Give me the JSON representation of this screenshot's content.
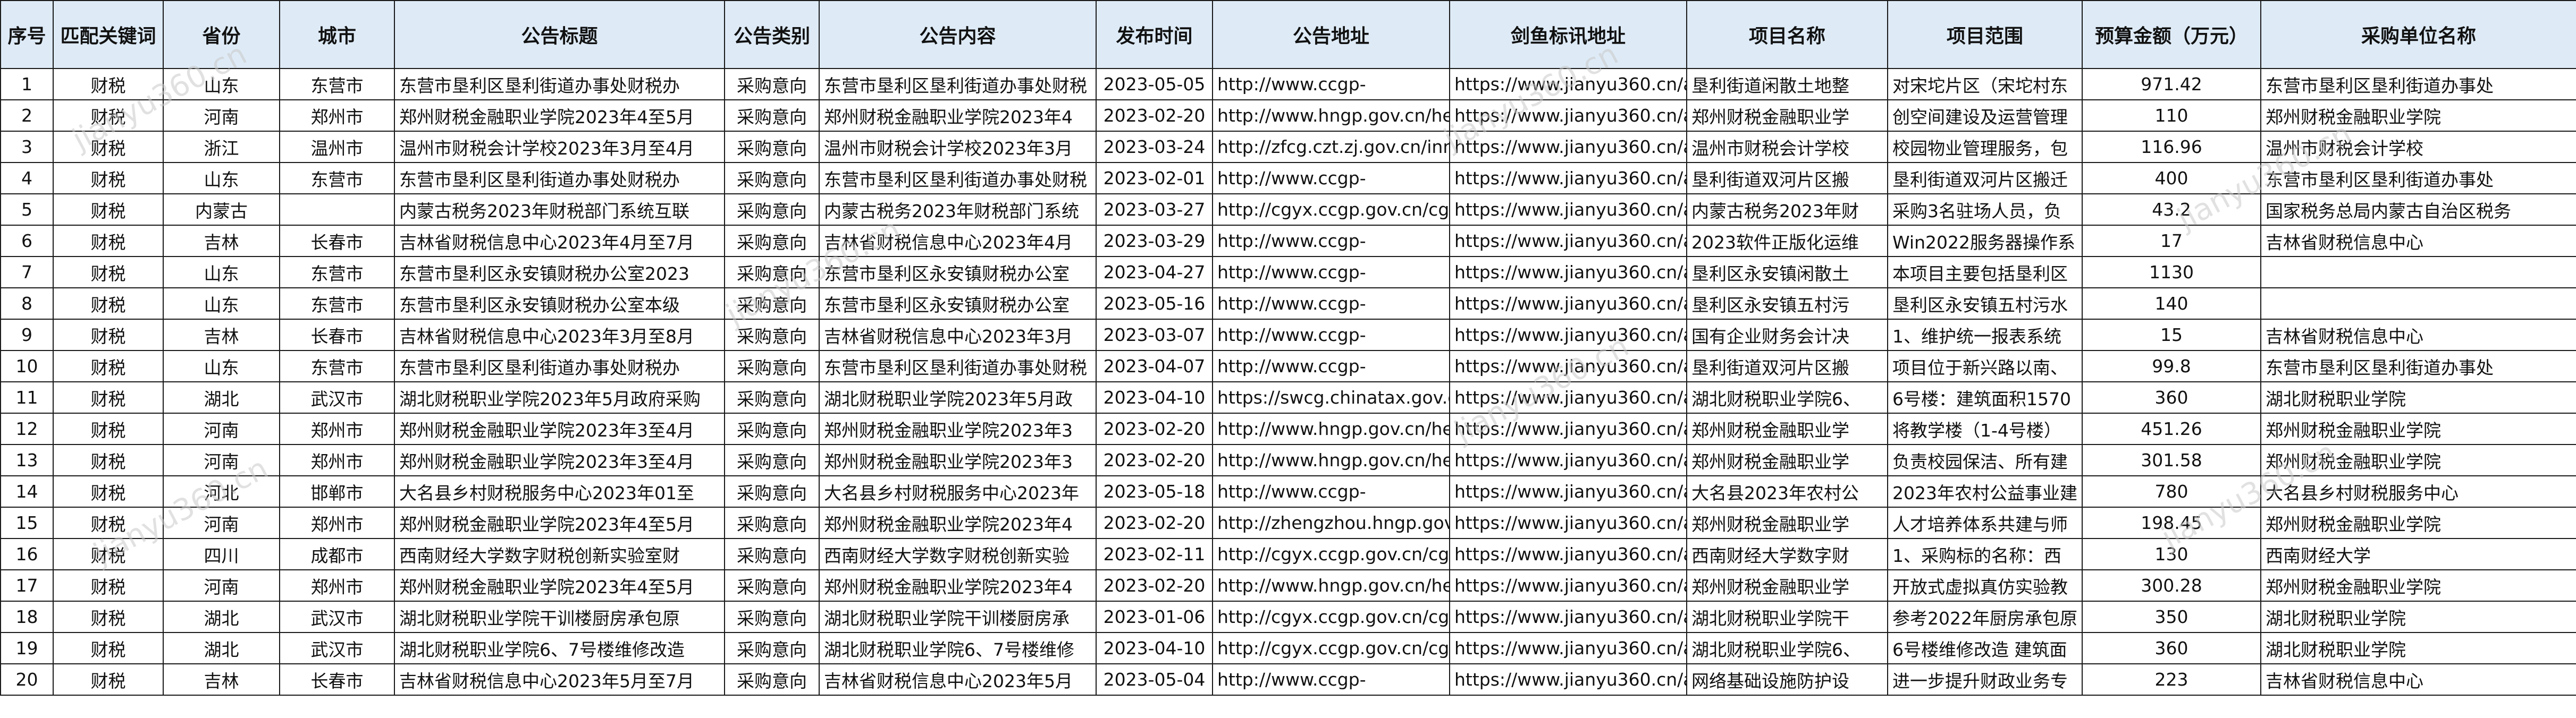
{
  "headers": [
    "序号",
    "匹配关键词",
    "省份",
    "城市",
    "公告标题",
    "公告类别",
    "公告内容",
    "发布时间",
    "公告地址",
    "剑鱼标讯地址",
    "项目名称",
    "项目范围",
    "预算金额（万元）",
    "采购单位名称"
  ],
  "watermark": "jianyu360.cn",
  "rows": [
    {
      "no": "1",
      "kw": "财税",
      "prov": "山东",
      "city": "东营市",
      "title": "东营市垦利区垦利街道办事处财税办",
      "cat": "采购意向",
      "content": "东营市垦利区垦利街道办事处财税",
      "date": "2023-05-05",
      "url": "http://www.ccgp-",
      "jy": "https://www.jianyu360.cn/ar",
      "proj": "垦利街道闲散土地整",
      "scope": "对宋坨片区（宋坨村东",
      "budget": "971.42",
      "buyer": "东营市垦利区垦利街道办事处"
    },
    {
      "no": "2",
      "kw": "财税",
      "prov": "河南",
      "city": "郑州市",
      "title": "郑州财税金融职业学院2023年4至5月",
      "cat": "采购意向",
      "content": "郑州财税金融职业学院2023年4",
      "date": "2023-02-20",
      "url": "http://www.hngp.gov.cn/he",
      "jy": "https://www.jianyu360.cn/ar",
      "proj": "郑州财税金融职业学",
      "scope": "创空间建设及运营管理",
      "budget": "110",
      "buyer": "郑州财税金融职业学院"
    },
    {
      "no": "3",
      "kw": "财税",
      "prov": "浙江",
      "city": "温州市",
      "title": "温州市财税会计学校2023年3月至4月",
      "cat": "采购意向",
      "content": "温州市财税会计学校2023年3月",
      "date": "2023-03-24",
      "url": "http://zfcg.czt.zj.gov.cn/inn",
      "jy": "https://www.jianyu360.cn/ar",
      "proj": "温州市财税会计学校",
      "scope": "校园物业管理服务，包",
      "budget": "116.96",
      "buyer": "温州市财税会计学校"
    },
    {
      "no": "4",
      "kw": "财税",
      "prov": "山东",
      "city": "东营市",
      "title": "东营市垦利区垦利街道办事处财税办",
      "cat": "采购意向",
      "content": "东营市垦利区垦利街道办事处财税",
      "date": "2023-02-01",
      "url": "http://www.ccgp-",
      "jy": "https://www.jianyu360.cn/ar",
      "proj": "垦利街道双河片区搬",
      "scope": "垦利街道双河片区搬迁",
      "budget": "400",
      "buyer": "东营市垦利区垦利街道办事处"
    },
    {
      "no": "5",
      "kw": "财税",
      "prov": "内蒙古",
      "city": "",
      "title": "内蒙古税务2023年财税部门系统互联",
      "cat": "采购意向",
      "content": "内蒙古税务2023年财税部门系统",
      "date": "2023-03-27",
      "url": "http://cgyx.ccgp.gov.cn/cgy",
      "jy": "https://www.jianyu360.cn/ar",
      "proj": "内蒙古税务2023年财",
      "scope": "采购3名驻场人员，负",
      "budget": "43.2",
      "buyer": "国家税务总局内蒙古自治区税务"
    },
    {
      "no": "6",
      "kw": "财税",
      "prov": "吉林",
      "city": "长春市",
      "title": "吉林省财税信息中心2023年4月至7月",
      "cat": "采购意向",
      "content": "吉林省财税信息中心2023年4月",
      "date": "2023-03-29",
      "url": "http://www.ccgp-",
      "jy": "https://www.jianyu360.cn/ar",
      "proj": "2023软件正版化运维",
      "scope": "Win2022服务器操作系",
      "budget": "17",
      "buyer": "吉林省财税信息中心"
    },
    {
      "no": "7",
      "kw": "财税",
      "prov": "山东",
      "city": "东营市",
      "title": "东营市垦利区永安镇财税办公室2023",
      "cat": "采购意向",
      "content": "东营市垦利区永安镇财税办公室",
      "date": "2023-04-27",
      "url": "http://www.ccgp-",
      "jy": "https://www.jianyu360.cn/ar",
      "proj": "垦利区永安镇闲散土",
      "scope": "本项目主要包括垦利区",
      "budget": "1130",
      "buyer": ""
    },
    {
      "no": "8",
      "kw": "财税",
      "prov": "山东",
      "city": "东营市",
      "title": "东营市垦利区永安镇财税办公室本级",
      "cat": "采购意向",
      "content": "东营市垦利区永安镇财税办公室",
      "date": "2023-05-16",
      "url": "http://www.ccgp-",
      "jy": "https://www.jianyu360.cn/ar",
      "proj": "垦利区永安镇五村污",
      "scope": "垦利区永安镇五村污水",
      "budget": "140",
      "buyer": ""
    },
    {
      "no": "9",
      "kw": "财税",
      "prov": "吉林",
      "city": "长春市",
      "title": "吉林省财税信息中心2023年3月至8月",
      "cat": "采购意向",
      "content": "吉林省财税信息中心2023年3月",
      "date": "2023-03-07",
      "url": "http://www.ccgp-",
      "jy": "https://www.jianyu360.cn/ar",
      "proj": "国有企业财务会计决",
      "scope": "1、维护统一报表系统",
      "budget": "15",
      "buyer": "吉林省财税信息中心"
    },
    {
      "no": "10",
      "kw": "财税",
      "prov": "山东",
      "city": "东营市",
      "title": "东营市垦利区垦利街道办事处财税办",
      "cat": "采购意向",
      "content": "东营市垦利区垦利街道办事处财税",
      "date": "2023-04-07",
      "url": "http://www.ccgp-",
      "jy": "https://www.jianyu360.cn/ar",
      "proj": "垦利街道双河片区搬",
      "scope": "项目位于新兴路以南、",
      "budget": "99.8",
      "buyer": "东营市垦利区垦利街道办事处"
    },
    {
      "no": "11",
      "kw": "财税",
      "prov": "湖北",
      "city": "武汉市",
      "title": "湖北财税职业学院2023年5月政府采购",
      "cat": "采购意向",
      "content": "湖北财税职业学院2023年5月政",
      "date": "2023-04-10",
      "url": "https://swcg.chinatax.gov.c",
      "jy": "https://www.jianyu360.cn/ar",
      "proj": "湖北财税职业学院6、",
      "scope": "6号楼：建筑面积1570",
      "budget": "360",
      "buyer": "湖北财税职业学院"
    },
    {
      "no": "12",
      "kw": "财税",
      "prov": "河南",
      "city": "郑州市",
      "title": "郑州财税金融职业学院2023年3至4月",
      "cat": "采购意向",
      "content": "郑州财税金融职业学院2023年3",
      "date": "2023-02-20",
      "url": "http://www.hngp.gov.cn/he",
      "jy": "https://www.jianyu360.cn/ar",
      "proj": "郑州财税金融职业学",
      "scope": "将教学楼（1-4号楼）",
      "budget": "451.26",
      "buyer": "郑州财税金融职业学院"
    },
    {
      "no": "13",
      "kw": "财税",
      "prov": "河南",
      "city": "郑州市",
      "title": "郑州财税金融职业学院2023年3至4月",
      "cat": "采购意向",
      "content": "郑州财税金融职业学院2023年3",
      "date": "2023-02-20",
      "url": "http://www.hngp.gov.cn/he",
      "jy": "https://www.jianyu360.cn/ar",
      "proj": "郑州财税金融职业学",
      "scope": "负责校园保洁、所有建",
      "budget": "301.58",
      "buyer": "郑州财税金融职业学院"
    },
    {
      "no": "14",
      "kw": "财税",
      "prov": "河北",
      "city": "邯郸市",
      "title": "大名县乡村财税服务中心2023年01至",
      "cat": "采购意向",
      "content": "大名县乡村财税服务中心2023年",
      "date": "2023-05-18",
      "url": "http://www.ccgp-",
      "jy": "https://www.jianyu360.cn/ar",
      "proj": "大名县2023年农村公",
      "scope": "2023年农村公益事业建",
      "budget": "780",
      "buyer": "大名县乡村财税服务中心"
    },
    {
      "no": "15",
      "kw": "财税",
      "prov": "河南",
      "city": "郑州市",
      "title": "郑州财税金融职业学院2023年4至5月",
      "cat": "采购意向",
      "content": "郑州财税金融职业学院2023年4",
      "date": "2023-02-20",
      "url": "http://zhengzhou.hngp.gov.",
      "jy": "https://www.jianyu360.cn/ar",
      "proj": "郑州财税金融职业学",
      "scope": "人才培养体系共建与师",
      "budget": "198.45",
      "buyer": "郑州财税金融职业学院"
    },
    {
      "no": "16",
      "kw": "财税",
      "prov": "四川",
      "city": "成都市",
      "title": "西南财经大学数字财税创新实验室财",
      "cat": "采购意向",
      "content": "西南财经大学数字财税创新实验",
      "date": "2023-02-11",
      "url": "http://cgyx.ccgp.gov.cn/cgy",
      "jy": "https://www.jianyu360.cn/ar",
      "proj": "西南财经大学数字财",
      "scope": "1、采购标的名称：西",
      "budget": "130",
      "buyer": "西南财经大学"
    },
    {
      "no": "17",
      "kw": "财税",
      "prov": "河南",
      "city": "郑州市",
      "title": "郑州财税金融职业学院2023年4至5月",
      "cat": "采购意向",
      "content": "郑州财税金融职业学院2023年4",
      "date": "2023-02-20",
      "url": "http://www.hngp.gov.cn/he",
      "jy": "https://www.jianyu360.cn/ar",
      "proj": "郑州财税金融职业学",
      "scope": "开放式虚拟真仿实验教",
      "budget": "300.28",
      "buyer": "郑州财税金融职业学院"
    },
    {
      "no": "18",
      "kw": "财税",
      "prov": "湖北",
      "city": "武汉市",
      "title": "湖北财税职业学院干训楼厨房承包原",
      "cat": "采购意向",
      "content": "湖北财税职业学院干训楼厨房承",
      "date": "2023-01-06",
      "url": "http://cgyx.ccgp.gov.cn/cgy",
      "jy": "https://www.jianyu360.cn/ar",
      "proj": "湖北财税职业学院干",
      "scope": "参考2022年厨房承包原",
      "budget": "350",
      "buyer": "湖北财税职业学院"
    },
    {
      "no": "19",
      "kw": "财税",
      "prov": "湖北",
      "city": "武汉市",
      "title": "湖北财税职业学院6、7号楼维修改造",
      "cat": "采购意向",
      "content": "湖北财税职业学院6、7号楼维修",
      "date": "2023-04-10",
      "url": "http://cgyx.ccgp.gov.cn/cgy",
      "jy": "https://www.jianyu360.cn/ar",
      "proj": "湖北财税职业学院6、",
      "scope": "6号楼维修改造 建筑面",
      "budget": "360",
      "buyer": "湖北财税职业学院"
    },
    {
      "no": "20",
      "kw": "财税",
      "prov": "吉林",
      "city": "长春市",
      "title": "吉林省财税信息中心2023年5月至7月",
      "cat": "采购意向",
      "content": "吉林省财税信息中心2023年5月",
      "date": "2023-05-04",
      "url": "http://www.ccgp-",
      "jy": "https://www.jianyu360.cn/ar",
      "proj": "网络基础设施防护设",
      "scope": "进一步提升财政业务专",
      "budget": "223",
      "buyer": "吉林省财税信息中心"
    }
  ]
}
